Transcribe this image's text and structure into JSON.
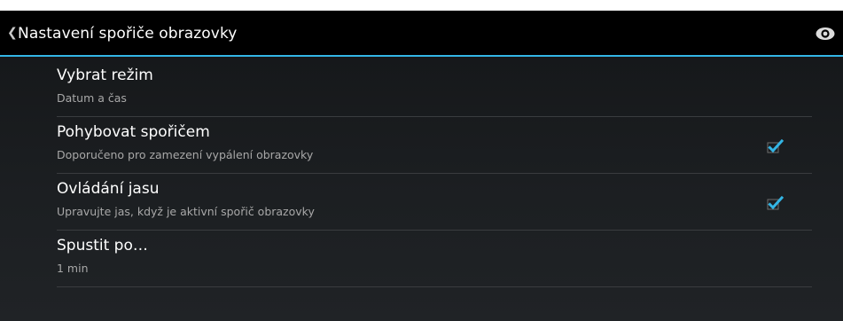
{
  "action_bar": {
    "title": "Nastavení spořiče obrazovky",
    "up_icon": "chevron-left-icon",
    "action_icon": "eye-icon",
    "accent_color": "#33b5e5"
  },
  "settings": [
    {
      "title": "Vybrat režim",
      "summary": "Datum a čas",
      "has_checkbox": false
    },
    {
      "title": "Pohybovat spořičem",
      "summary": "Doporučeno pro zamezení vypálení obrazovky",
      "has_checkbox": true,
      "checked": true
    },
    {
      "title": "Ovládání jasu",
      "summary": "Upravujte jas, když je aktivní spořič obrazovky",
      "has_checkbox": true,
      "checked": true
    },
    {
      "title": "Spustit po…",
      "summary": "1 min",
      "has_checkbox": false
    }
  ]
}
